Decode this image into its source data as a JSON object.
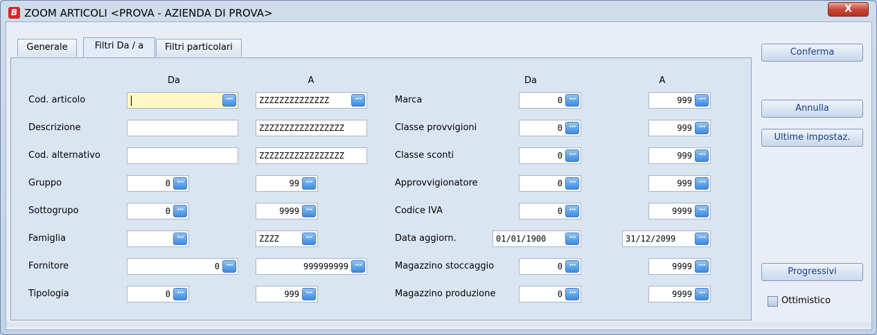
{
  "window": {
    "title": "ZOOM ARTICOLI <PROVA - AZIENDA DI PROVA>",
    "app_icon_letter": "B",
    "close_glyph": "X"
  },
  "tabs": [
    {
      "label": "Generale",
      "active": false
    },
    {
      "label": "Filtri Da / a",
      "active": true
    },
    {
      "label": "Filtri particolari",
      "active": false
    }
  ],
  "headers": {
    "left_from": "Da",
    "left_to": "A",
    "right_from": "Da",
    "right_to": "A"
  },
  "lookup_glyph": "···",
  "left_rows": [
    {
      "label": "Cod. articolo",
      "from": "",
      "to": "ZZZZZZZZZZZZZZ"
    },
    {
      "label": "Descrizione",
      "from": "",
      "to": "ZZZZZZZZZZZZZZZZZ"
    },
    {
      "label": "Cod. alternativo",
      "from": "",
      "to": "ZZZZZZZZZZZZZZZZZ"
    },
    {
      "label": "Gruppo",
      "from": "0",
      "to": "99"
    },
    {
      "label": "Sottogrupo",
      "from": "0",
      "to": "9999"
    },
    {
      "label": "Famiglia",
      "from": "",
      "to": "ZZZZ"
    },
    {
      "label": "Fornitore",
      "from": "0",
      "to": "999999999"
    },
    {
      "label": "Tipologia",
      "from": "0",
      "to": "999"
    }
  ],
  "right_rows": [
    {
      "label": "Marca",
      "from": "0",
      "to": "999"
    },
    {
      "label": "Classe provvigioni",
      "from": "0",
      "to": "999"
    },
    {
      "label": "Classe sconti",
      "from": "0",
      "to": "999"
    },
    {
      "label": "Approvvigionatore",
      "from": "0",
      "to": "999"
    },
    {
      "label": "Codice IVA",
      "from": "0",
      "to": "9999"
    },
    {
      "label": "Data aggiorn.",
      "from": "01/01/1900",
      "to": "31/12/2099"
    },
    {
      "label": "Magazzino stoccaggio",
      "from": "0",
      "to": "9999"
    },
    {
      "label": "Magazzino produzione",
      "from": "0",
      "to": "9999"
    }
  ],
  "buttons": {
    "confirm": "Conferma",
    "cancel": "Annulla",
    "last_settings": "Ultime impostaz.",
    "progressive": "Progressivi"
  },
  "checkbox": {
    "label": "Ottimistico",
    "checked": false
  }
}
